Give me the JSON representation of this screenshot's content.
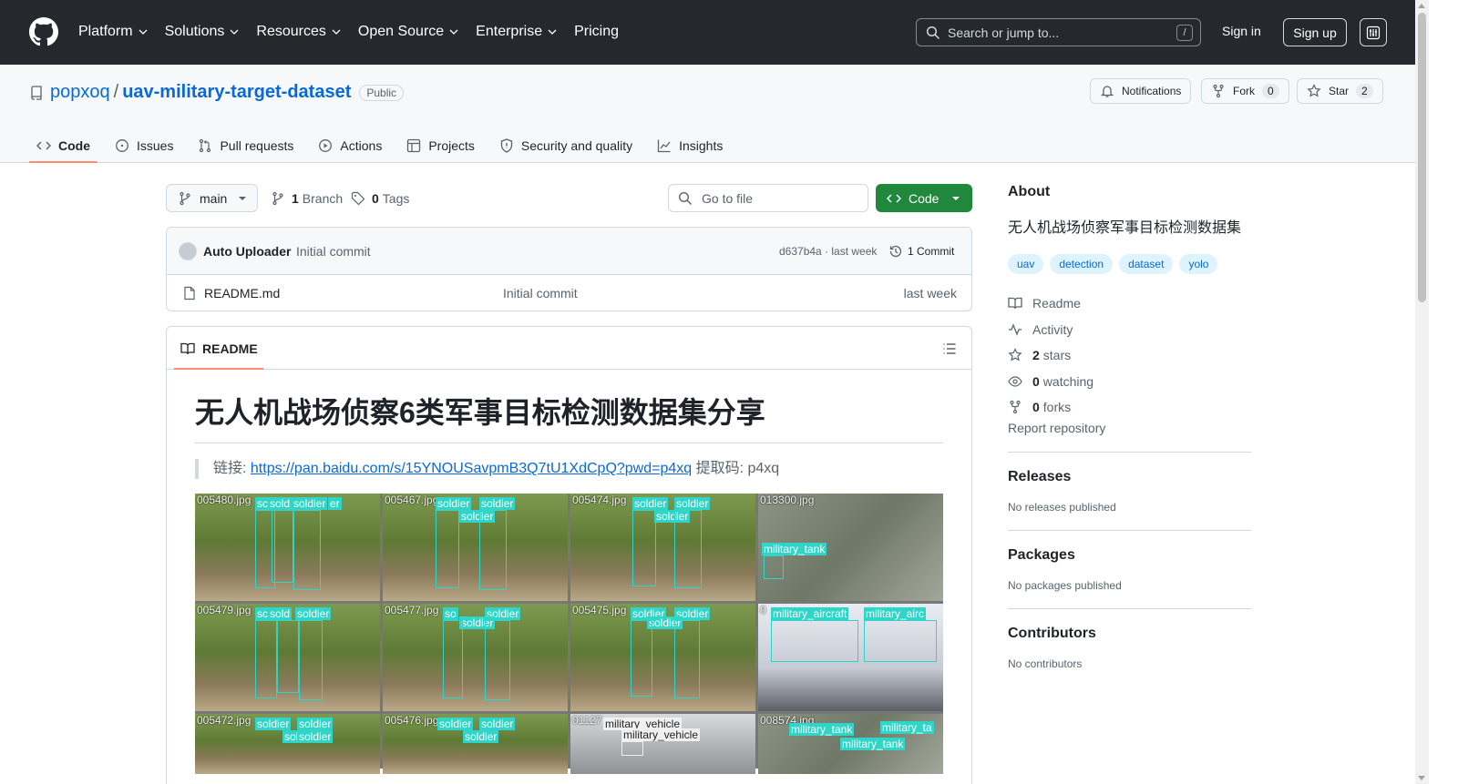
{
  "header": {
    "nav": [
      "Platform",
      "Solutions",
      "Resources",
      "Open Source",
      "Enterprise",
      "Pricing"
    ],
    "search_placeholder": "Search or jump to...",
    "search_shortcut": "/",
    "sign_in": "Sign in",
    "sign_up": "Sign up"
  },
  "repo": {
    "owner": "popxoq",
    "separator": "/",
    "name": "uav-military-target-dataset",
    "visibility": "Public",
    "notifications_label": "Notifications",
    "fork_label": "Fork",
    "fork_count": "0",
    "star_label": "Star",
    "star_count": "2"
  },
  "tabs": [
    "Code",
    "Issues",
    "Pull requests",
    "Actions",
    "Projects",
    "Security and quality",
    "Insights"
  ],
  "toolbar": {
    "branch": "main",
    "branch_count": "1",
    "branch_label": "Branch",
    "tag_count": "0",
    "tag_label": "Tags",
    "go_to_file": "Go to file",
    "code_button": "Code"
  },
  "commit": {
    "author": "Auto Uploader",
    "message": "Initial commit",
    "hash_time": "d637b4a · last week",
    "count": "1 Commit"
  },
  "files": [
    {
      "name": "README.md",
      "message": "Initial commit",
      "time": "last week"
    }
  ],
  "readme": {
    "tab": "README",
    "title": "无人机战场侦察6类军事目标检测数据集分享",
    "link_prefix": "链接: ",
    "link": "https://pan.baidu.com/s/15YNOUSavpmB3Q7tU1XdCpQ?pwd=p4xq",
    "link_suffix": " 提取码: p4xq",
    "image_cells": [
      {
        "file": "005480.jpg",
        "labels": [
          "sc",
          "sold",
          "soldier",
          "er"
        ]
      },
      {
        "file": "005467.jpg",
        "labels": [
          "soldier",
          "soldier",
          "soldier"
        ]
      },
      {
        "file": "005474.jpg",
        "labels": [
          "soldier",
          "soldier",
          "soldier"
        ]
      },
      {
        "file": "013300.jpg",
        "labels": [
          "military_tank"
        ]
      },
      {
        "file": "005479.jpg",
        "labels": [
          "sc",
          "sold",
          "soldier"
        ]
      },
      {
        "file": "005477.jpg",
        "labels": [
          "so",
          "soldier",
          "soldier"
        ]
      },
      {
        "file": "005475.jpg",
        "labels": [
          "soldier",
          "soldier",
          "soldier"
        ]
      },
      {
        "file": "0",
        "labels": [
          "military_aircraft",
          "military_airc"
        ]
      },
      {
        "file": "005472.jpg",
        "labels": [
          "soldier",
          "soldier",
          "sol",
          "soldier"
        ]
      },
      {
        "file": "005476.jpg",
        "labels": [
          "soldier",
          "soldier",
          "soldier"
        ]
      },
      {
        "file": "01127",
        "labels": [
          "military_vehicle",
          "military_vehicle"
        ]
      },
      {
        "file": "008574.jpg",
        "labels": [
          "military_tank",
          "military_ta",
          "military_tank"
        ]
      }
    ]
  },
  "about": {
    "title": "About",
    "description": "无人机战场侦察军事目标检测数据集",
    "topics": [
      "uav",
      "detection",
      "dataset",
      "yolo"
    ],
    "readme": "Readme",
    "activity": "Activity",
    "stars_count": "2",
    "stars_label": "stars",
    "watching_count": "0",
    "watching_label": "watching",
    "forks_count": "0",
    "forks_label": "forks",
    "report": "Report repository"
  },
  "releases": {
    "title": "Releases",
    "empty": "No releases published"
  },
  "packages": {
    "title": "Packages",
    "empty": "No packages published"
  },
  "contributors": {
    "title": "Contributors",
    "empty": "No contributors"
  },
  "colors": {
    "header_bg": "#25292e",
    "accent": "#0969da",
    "green": "#1f883d",
    "tab_underline": "#fd8c73"
  }
}
